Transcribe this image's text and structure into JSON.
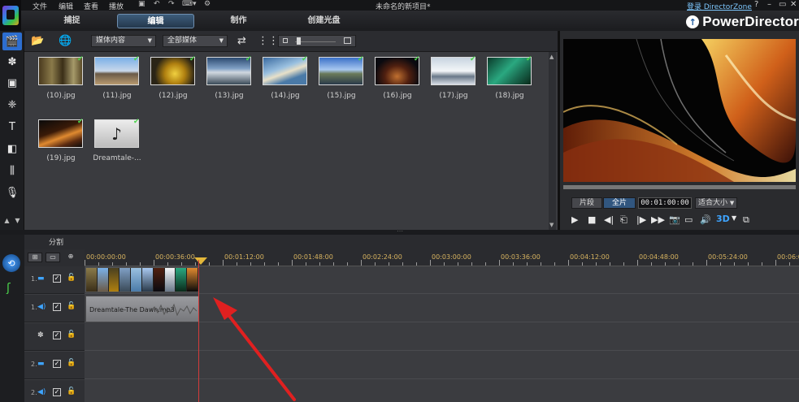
{
  "menu": {
    "items": [
      "文件",
      "编辑",
      "查看",
      "播放"
    ]
  },
  "window": {
    "title": "未命名的新项目*",
    "login_link": "登录 DirectorZone",
    "help": "?",
    "minimize": "–",
    "maximize": "▭",
    "close": "✕"
  },
  "modes": {
    "tabs": [
      "捕捉",
      "编辑",
      "制作",
      "创建光盘"
    ],
    "active": "编辑"
  },
  "brand": {
    "name": "PowerDirector",
    "icon": "up-arrow-circle-icon"
  },
  "library": {
    "filter_select": "媒体内容",
    "type_select": "全部媒体",
    "items": [
      {
        "label": "(10).jpg"
      },
      {
        "label": "(11).jpg"
      },
      {
        "label": "(12).jpg"
      },
      {
        "label": "(13).jpg"
      },
      {
        "label": "(14).jpg"
      },
      {
        "label": "(15).jpg"
      },
      {
        "label": "(16).jpg"
      },
      {
        "label": "(17).jpg"
      },
      {
        "label": "(18).jpg"
      },
      {
        "label": "(19).jpg"
      },
      {
        "label": "Dreamtale-..."
      }
    ]
  },
  "preview": {
    "clip_btn": "片段",
    "movie_btn": "全片",
    "timecode": "00:01:00:00",
    "fit_select": "适合大小",
    "btn_3d": "3D"
  },
  "timeline": {
    "split_tab": "分割",
    "ruler": [
      "00:00:00:00",
      "00:00:36:00",
      "00:01:12:00",
      "00:01:48:00",
      "00:02:24:00",
      "00:03:00:00",
      "00:03:36:00",
      "00:04:12:00",
      "00:04:48:00",
      "00:05:24:00",
      "00:06:0"
    ],
    "tracks": [
      {
        "num": "1.",
        "type": "video"
      },
      {
        "num": "1.",
        "type": "audio"
      },
      {
        "num": "",
        "type": "effect"
      },
      {
        "num": "2.",
        "type": "video"
      },
      {
        "num": "2.",
        "type": "audio"
      }
    ],
    "audio_clip_label": "Dreamtale-The Dawn.mp3"
  },
  "colors": {
    "accent": "#2d6ed0",
    "playhead": "#d43a3a",
    "check": "#4cd44c",
    "ruler_text": "#d8b460"
  }
}
